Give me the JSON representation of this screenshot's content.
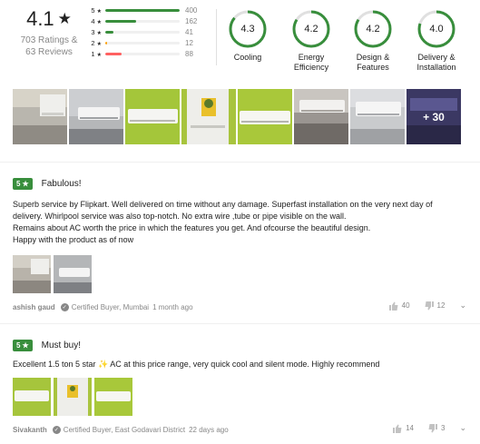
{
  "summary": {
    "overall_rating": "4.1",
    "ratings_text": "703 Ratings &",
    "reviews_text": "63 Reviews",
    "distribution": [
      {
        "star": "5",
        "count": "400",
        "share": 1.0,
        "color": "#388e3c"
      },
      {
        "star": "4",
        "count": "162",
        "share": 0.41,
        "color": "#388e3c"
      },
      {
        "star": "3",
        "count": "41",
        "share": 0.11,
        "color": "#388e3c"
      },
      {
        "star": "2",
        "count": "12",
        "share": 0.03,
        "color": "#ff9f00"
      },
      {
        "star": "1",
        "count": "88",
        "share": 0.22,
        "color": "#ff6161"
      }
    ]
  },
  "aspects": [
    {
      "value": "4.3",
      "name": "Cooling",
      "fraction": 0.86
    },
    {
      "value": "4.2",
      "name": "Energy\nEfficiency",
      "fraction": 0.84
    },
    {
      "value": "4.2",
      "name": "Design &\nFeatures",
      "fraction": 0.84
    },
    {
      "value": "4.0",
      "name": "Delivery &\nInstallation",
      "fraction": 0.8
    }
  ],
  "photos_more": "+ 30",
  "reviews": [
    {
      "rating": "5",
      "title": "Fabulous!",
      "body_lines": [
        "Superb service by Flipkart. Well delivered on time without any damage. Superfast installation on the very next day of",
        "delivery. Whirlpool service was also top-notch. No extra wire ,tube or pipe visible on the wall.",
        "Remains about AC worth the price in which the features you get. And ofcourse the beautiful design.",
        "Happy with the product as of now"
      ],
      "author": "ashish gaud",
      "certified": "Certified Buyer, Mumbai",
      "time": "1 month ago",
      "upvotes": "40",
      "downvotes": "12"
    },
    {
      "rating": "5",
      "title": "Must buy!",
      "body_lines": [
        "Excellent 1.5 ton 5 star ✨ AC at this price range, very quick cool and silent mode. Highly recommend"
      ],
      "author": "Sivakanth",
      "certified": "Certified Buyer, East Godavari District",
      "time": "22 days ago",
      "upvotes": "14",
      "downvotes": "3"
    }
  ],
  "colors": {
    "rating_green": "#388e3c",
    "muted_text": "#878787",
    "accent_yellow": "#ff9f00",
    "accent_red": "#ff6161"
  }
}
